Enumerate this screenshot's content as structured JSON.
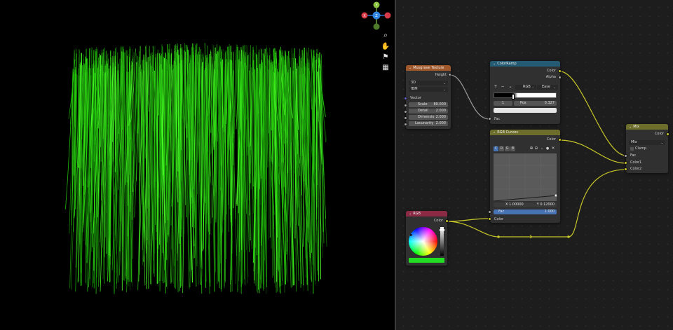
{
  "colors": {
    "grass": "#2ad80d",
    "musgrave_header": "#a0582a",
    "colorramp_header": "#245a72",
    "rgbcurves_header": "#6e6e2c",
    "rgb_header": "#8a2a44",
    "mix_header": "#6e6e2c",
    "socket_color": "#c7c729",
    "socket_float": "#a1a1a1",
    "socket_vector": "#6363c7",
    "rgb_value": "#22dd22"
  },
  "viewport": {
    "gizmo": {
      "z_label": "Z",
      "y_label": "Y",
      "x_label": "X"
    },
    "nav_icons": [
      "zoom-icon",
      "hand-icon",
      "camera-icon",
      "grid-icon"
    ]
  },
  "nodes": {
    "musgrave": {
      "title": "Musgrave Texture",
      "output_height": "Height",
      "dim_select": "3D",
      "type_select": "fBM",
      "input_vector": "Vector",
      "fields": [
        {
          "label": "Scale",
          "value": "80.000"
        },
        {
          "label": "Detail",
          "value": "2.000"
        },
        {
          "label": "Dimensio",
          "value": "2.000"
        },
        {
          "label": "Lacunarity",
          "value": "2.000"
        }
      ]
    },
    "colorramp": {
      "title": "ColorRamp",
      "output_color": "Color",
      "output_alpha": "Alpha",
      "add": "+",
      "remove": "−",
      "more": "⌄",
      "mode": "RGB",
      "interp": "Ease",
      "index": "1",
      "pos_label": "Pos",
      "pos_value": "0.327",
      "input_fac": "Fac"
    },
    "rgbcurves": {
      "title": "RGB Curves",
      "output_color": "Color",
      "channels": [
        "C",
        "R",
        "G",
        "B"
      ],
      "x_readout": "X 1.00000",
      "y_readout": "Y 0.12000",
      "fac_label": "Fac",
      "fac_value": "1.000",
      "input_color": "Color"
    },
    "rgb": {
      "title": "RGB",
      "output_color": "Color"
    },
    "mix": {
      "title": "Mix",
      "output_color": "Color",
      "blend_select": "Mix",
      "clamp_label": "Clamp",
      "input_fac": "Fac",
      "input_color1": "Color1",
      "input_color2": "Color2"
    }
  }
}
